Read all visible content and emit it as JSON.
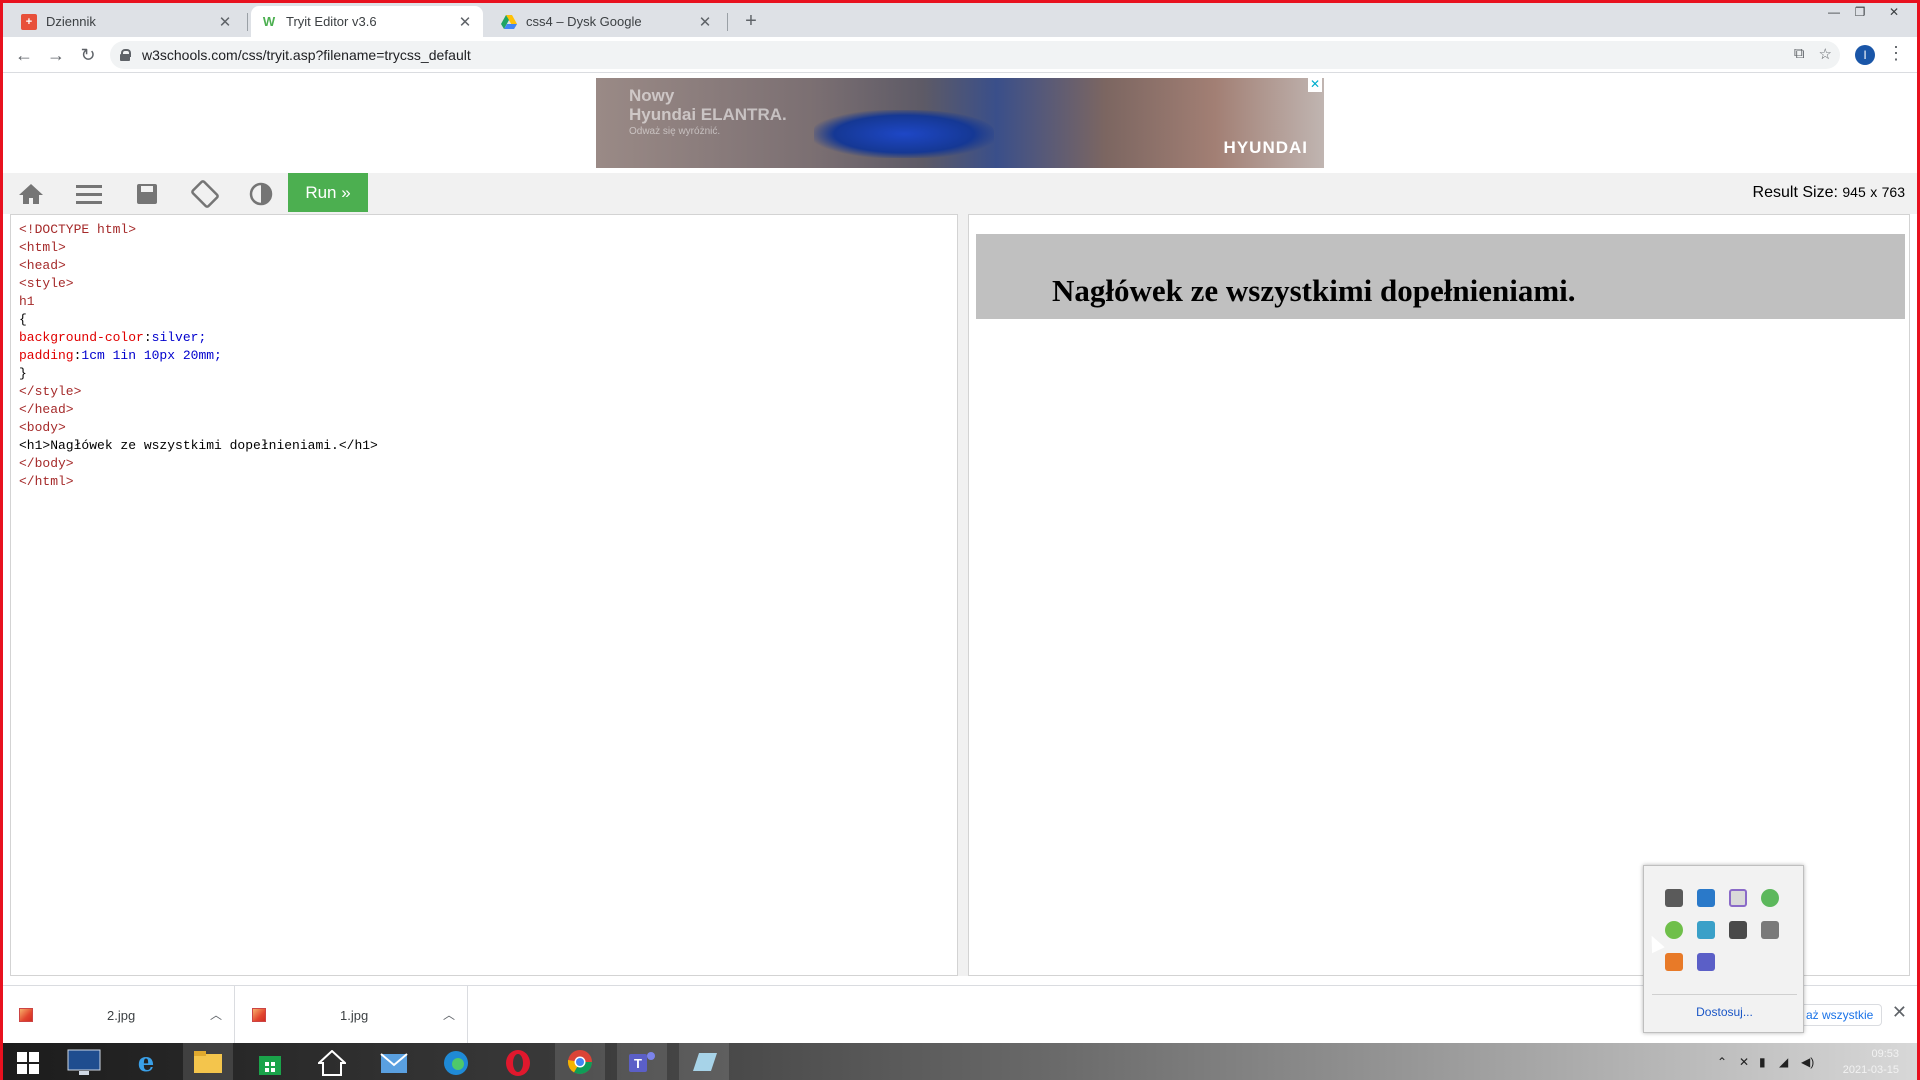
{
  "browser": {
    "tabs": [
      {
        "title": "Dziennik",
        "icon": "dziennik-icon",
        "color": "#e8503a"
      },
      {
        "title": "Tryit Editor v3.6",
        "icon": "w3schools-icon",
        "color": "#4caf50"
      },
      {
        "title": "css4 – Dysk Google",
        "icon": "google-drive-icon",
        "color": "#1fa463"
      }
    ],
    "active_tab_index": 1,
    "url": "w3schools.com/css/tryit.asp?filename=trycss_default",
    "profile_initial": "I"
  },
  "ad": {
    "headline_line1": "Nowy",
    "headline_line2": "Hyundai ELANTRA.",
    "subline": "Odważ się wyróżnić.",
    "brand": "HYUNDAI"
  },
  "editor": {
    "run_label": "Run »",
    "result_size_label": "Result Size:",
    "result_width": "945",
    "result_x": "x",
    "result_height": "763",
    "code_lines": [
      "<!DOCTYPE html>",
      "<html>",
      "<head>",
      "<style>",
      "h1",
      "{",
      "background-color:silver;",
      "padding:1cm 1in 10px 20mm;",
      "}",
      "</style>",
      "</head>",
      "<body>",
      "<h1>Nagłówek ze wszystkimi dopełnieniami.</h1>",
      "</body>",
      "</html>"
    ],
    "result_heading": "Nagłówek ze wszystkimi dopełnieniami."
  },
  "downloads": {
    "items": [
      {
        "name": "2.jpg"
      },
      {
        "name": "1.jpg"
      }
    ],
    "show_all_label": "aż wszystkie"
  },
  "tray_popup": {
    "customize_label": "Dostosuj..."
  },
  "taskbar": {
    "time": "09:53",
    "date": "2021-03-15"
  }
}
